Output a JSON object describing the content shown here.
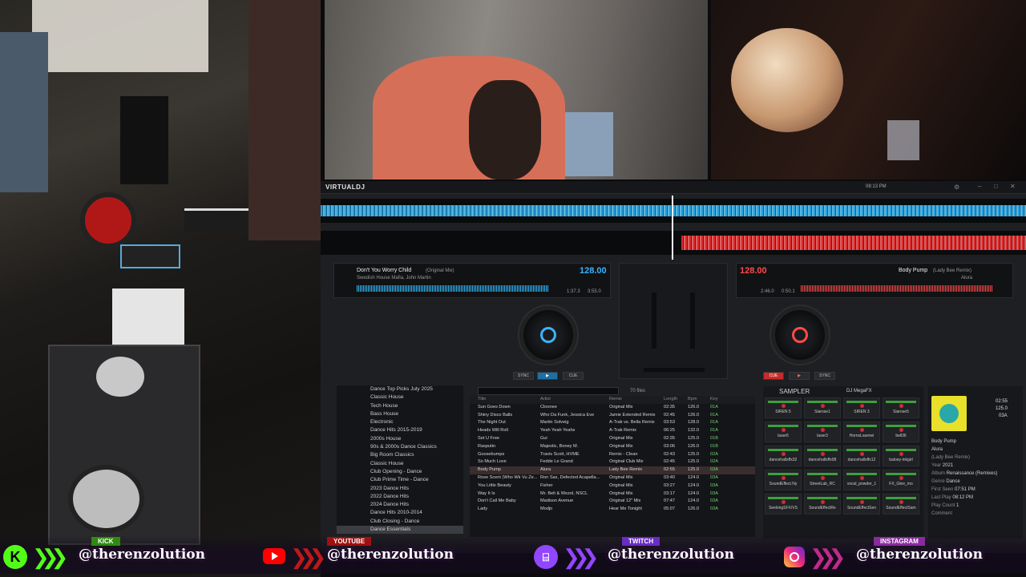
{
  "app": {
    "name": "VIRTUALDJ",
    "time": "08:13 PM"
  },
  "deck_left": {
    "title": "Don't You Worry Child",
    "mix": "(Original Mix)",
    "artist": "Swedish House Mafia, John Martin",
    "bpm": "128.00",
    "elapsed": "1:37.3",
    "remain": "3:55.0",
    "buttons": [
      "SYNC",
      "CUE",
      "PLAY"
    ],
    "color": "#3ab4ff"
  },
  "deck_right": {
    "title": "Body Pump",
    "mix": "(Lady Bee Remix)",
    "artist": "Alura",
    "bpm": "128.00",
    "elapsed": "2:46.0",
    "remain": "0:50.1",
    "buttons": [
      "SYNC",
      "CUE",
      "PLAY"
    ],
    "color": "#ff4a4a"
  },
  "folders": [
    "Dance Top Picks July 2025",
    "Classic House",
    "Tech House",
    "Bass House",
    "Electronic",
    "Dance Hits 2015-2019",
    "2000s House",
    "90s & 2000s Dance Classics",
    "Big Room Classics",
    "Classic House",
    "Club Opening - Dance",
    "Club Prime Time - Dance",
    "2023 Dance Hits",
    "2022 Dance Hits",
    "2024 Dance Hits",
    "Dance Hits 2010-2014",
    "Club Closing - Dance",
    "Dance Essentials"
  ],
  "list": {
    "count": "70 files",
    "headers": [
      "Title",
      "Artist",
      "Remix",
      "Length",
      "Bpm",
      "Key"
    ],
    "rows": [
      [
        "Sun Goes Down",
        "Cloonee",
        "Original Mix",
        "02:35",
        "126.0",
        "01A"
      ],
      [
        "Shiny Disco Balls",
        "Who Da Funk, Jessica Eve",
        "Jamie Extended Remix",
        "02:45",
        "126.0",
        "01A"
      ],
      [
        "The Night Out",
        "Martin Solveig",
        "A-Trak vs. Bella Remix",
        "03:53",
        "128.0",
        "01A"
      ],
      [
        "Heads Will Roll",
        "Yeah Yeah Yeahs",
        "A-Trak Remix",
        "06:25",
        "132.0",
        "01A"
      ],
      [
        "Set U Free",
        "Gui",
        "Original Mix",
        "02:35",
        "125.0",
        "01B"
      ],
      [
        "Rasputin",
        "Majestic, Boney M.",
        "Original Mix",
        "03:06",
        "126.0",
        "01B"
      ],
      [
        "Goosebumps",
        "Travis Scott, HVME",
        "Remix - Clean",
        "02:43",
        "125.0",
        "02A"
      ],
      [
        "So Much Love",
        "Fedde Le Grand",
        "Original Club Mix",
        "02:45",
        "125.0",
        "02A"
      ],
      [
        "Body Pump",
        "Alura",
        "Lady Bee Remix",
        "02:55",
        "125.0",
        "03A"
      ],
      [
        "Rose Scent (Who Wk Vu Ze...",
        "Ron Sax, Defected Acapella...",
        "Original Mix",
        "03:40",
        "124.0",
        "03A"
      ],
      [
        "You Little Beauty",
        "Fisher",
        "Original Mix",
        "03:27",
        "124.0",
        "03A"
      ],
      [
        "Way It Is",
        "Mr. Belt & Wezol, NSCL",
        "Original Mix",
        "03:17",
        "124.0",
        "03A"
      ],
      [
        "Don't Call Me Baby",
        "Madison Avenue",
        "Original 12\" Mix",
        "07:47",
        "124.0",
        "03A"
      ],
      [
        "Lady",
        "Modjo",
        "Hear Me Tonight",
        "05:07",
        "126.0",
        "03A"
      ]
    ]
  },
  "sampler": {
    "label": "SAMPLER",
    "bank": "DJ MegaFX",
    "pads": [
      "SIREN 5",
      "Siarose1",
      "SIREN 3",
      "Siarose5",
      "laser6",
      "laser3",
      "HornsLaserwi",
      "bell36",
      "dancehallsffx32",
      "dancehallsffx08",
      "dancehallsffx12",
      "baloey-inkgirl",
      "SoundEffect.Ny",
      "StreetLab_RC",
      "vocal_powder_1",
      "FX_Glee_mo",
      "SeekingSFX/VS",
      "SoundEffectRe",
      "SoundEffectSen",
      "SoundEffectSam"
    ]
  },
  "track_info": {
    "bpm": "125.0",
    "key": "03A",
    "length": "02:55",
    "title": "Body Pump",
    "artist": "Alura",
    "remix": "(Lady Bee Remix)",
    "year_label": "Year",
    "year": "2021",
    "album_label": "Album",
    "album": "Renaissance (Remixes)",
    "genre_label": "Genre",
    "genre": "Dance",
    "first_seen_label": "First Seen",
    "first_seen": "07:51 PM",
    "last_play_label": "Last Play",
    "last_play": "08:12 PM",
    "play_count_label": "Play Count",
    "play_count": "1",
    "comment_label": "Comment"
  },
  "social": [
    {
      "tag": "KICK",
      "handle": "@therenzolution",
      "color": "#53fc18",
      "icon": "kick-icon"
    },
    {
      "tag": "YOUTUBE",
      "handle": "@therenzolution",
      "color": "#ff0000",
      "icon": "youtube-icon"
    },
    {
      "tag": "TWITCH",
      "handle": "@therenzolution",
      "color": "#9146ff",
      "icon": "twitch-icon"
    },
    {
      "tag": "INSTAGRAM",
      "handle": "@therenzolution",
      "color": "#e1306c",
      "icon": "instagram-icon"
    }
  ]
}
